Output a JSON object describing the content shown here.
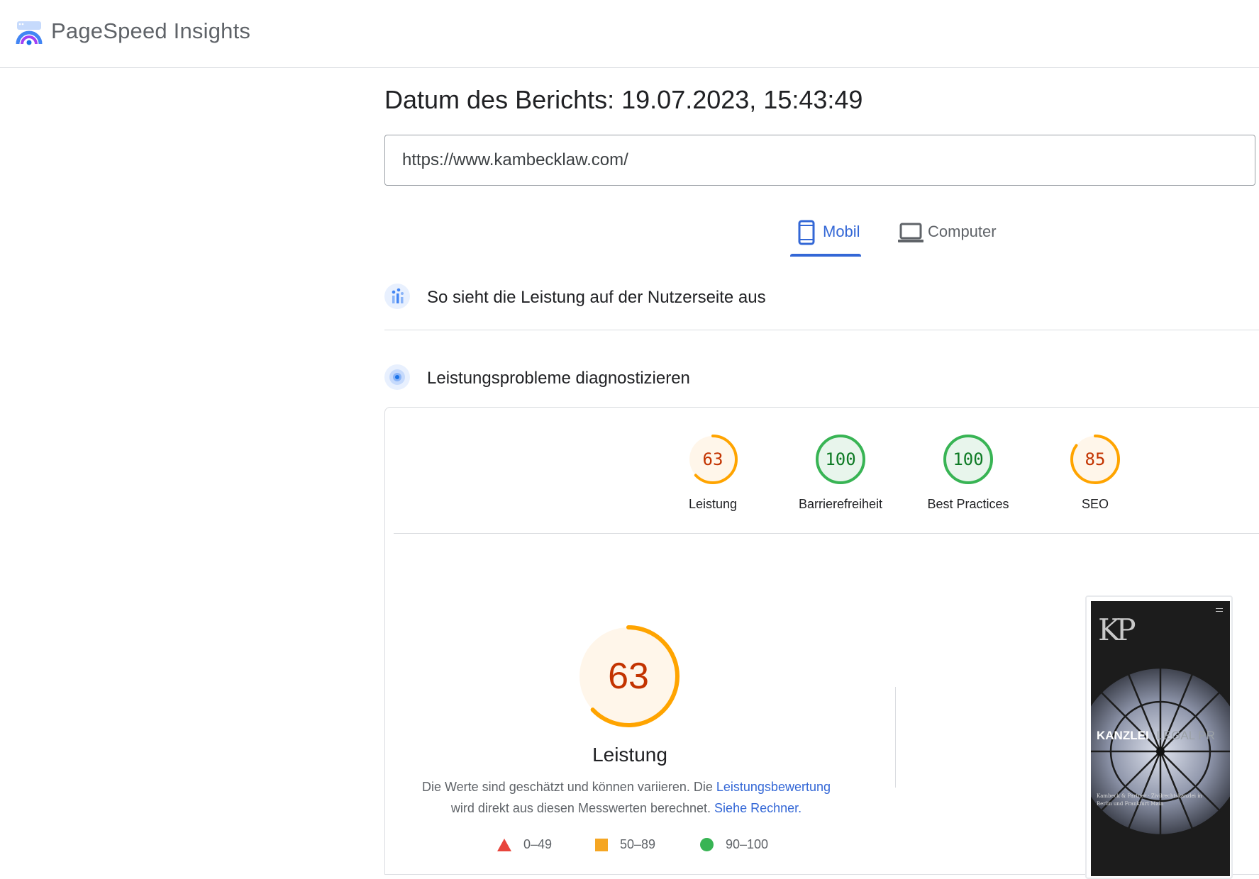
{
  "app": {
    "title": "PageSpeed Insights",
    "logo_icon": "pagespeed-logo-icon"
  },
  "report": {
    "date_label": "Datum des Berichts: 19.07.2023, 15:43:49",
    "url": "https://www.kambecklaw.com/"
  },
  "tabs": [
    {
      "label": "Mobil",
      "icon": "smartphone-icon",
      "selected": true
    },
    {
      "label": "Computer",
      "icon": "laptop-icon",
      "selected": false
    }
  ],
  "sections": {
    "field_data": {
      "title": "So sieht die Leistung auf der Nutzerseite aus",
      "icon": "users-chart-icon"
    },
    "diagnose": {
      "title": "Leistungsprobleme diagnostizieren",
      "icon": "lighthouse-icon"
    }
  },
  "scores": [
    {
      "value": "63",
      "label": "Leistung",
      "score": 0.63,
      "rating": "average"
    },
    {
      "value": "100",
      "label": "Barrierefreiheit",
      "score": 1.0,
      "rating": "pass"
    },
    {
      "value": "100",
      "label": "Best Practices",
      "score": 1.0,
      "rating": "pass"
    },
    {
      "value": "85",
      "label": "SEO",
      "score": 0.85,
      "rating": "average"
    }
  ],
  "performance": {
    "value": "63",
    "score": 0.63,
    "title": "Leistung",
    "desc_part1": "Die Werte sind geschätzt und können variieren. Die ",
    "desc_link1": "Leistungsbewertung",
    "desc_part2": "wird direkt aus diesen Messwerten berechnet. ",
    "desc_link2": "Siehe Rechner."
  },
  "legend": [
    {
      "range": "0–49",
      "shape": "triangle",
      "color": "#e8453c"
    },
    {
      "range": "50–89",
      "shape": "square",
      "color": "#f5a623"
    },
    {
      "range": "90–100",
      "shape": "circle",
      "color": "#38b454"
    }
  ],
  "screenshot": {
    "logo_text": "KP",
    "headline": "KANZLEI",
    "headline_faded": "LEGAL PR",
    "caption_line1": "Kambeck & Partner · Zivilrechtskanzlei in",
    "caption_line2": "Berlin und Frankfurt Main",
    "menu_icon": "menu-icon"
  },
  "colors": {
    "accent_blue": "#3367d6",
    "average_orange": "#ffa400",
    "pass_green": "#0cce6b",
    "fail_red": "#ff4e42"
  }
}
